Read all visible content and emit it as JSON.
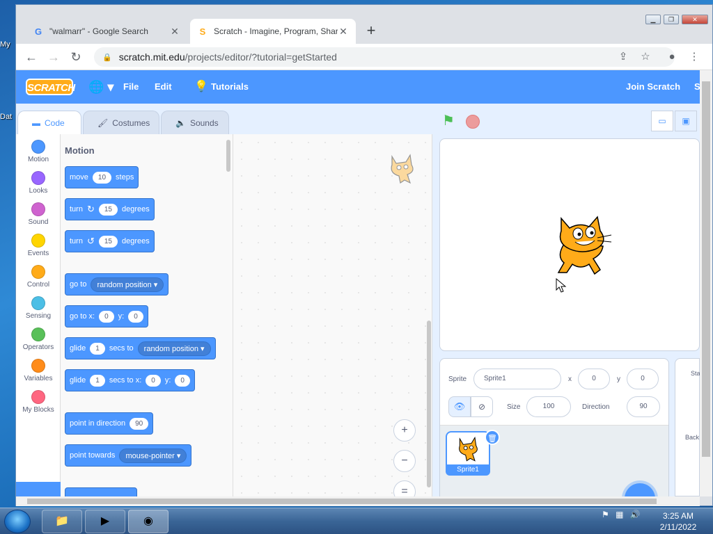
{
  "desktop": {
    "icons": [
      "My",
      "Dat"
    ]
  },
  "browser": {
    "tabs": [
      {
        "title": "\"walmarr\" - Google Search",
        "favicon": "G",
        "active": false
      },
      {
        "title": "Scratch - Imagine, Program, Shar",
        "favicon": "S",
        "active": true
      }
    ],
    "new_tab": "+",
    "url_domain": "scratch.mit.edu",
    "url_path": "/projects/editor/?tutorial=getStarted"
  },
  "scratch": {
    "logo": "SCRATCH",
    "menu": {
      "file": "File",
      "edit": "Edit",
      "tutorials": "Tutorials",
      "join": "Join Scratch",
      "signin": "S"
    },
    "tabs": {
      "code": "Code",
      "costumes": "Costumes",
      "sounds": "Sounds"
    },
    "categories": [
      {
        "label": "Motion",
        "color": "#4c97ff"
      },
      {
        "label": "Looks",
        "color": "#9966ff"
      },
      {
        "label": "Sound",
        "color": "#cf63cf"
      },
      {
        "label": "Events",
        "color": "#ffd500"
      },
      {
        "label": "Control",
        "color": "#ffab19"
      },
      {
        "label": "Sensing",
        "color": "#4cbfe6"
      },
      {
        "label": "Operators",
        "color": "#59c059"
      },
      {
        "label": "Variables",
        "color": "#ff8c1a"
      },
      {
        "label": "My Blocks",
        "color": "#ff6680"
      }
    ],
    "palette": {
      "heading": "Motion",
      "move": {
        "a": "move",
        "v": "10",
        "b": "steps"
      },
      "turn_right": {
        "a": "turn",
        "v": "15",
        "b": "degrees"
      },
      "turn_left": {
        "a": "turn",
        "v": "15",
        "b": "degrees"
      },
      "goto": {
        "a": "go to",
        "d": "random position"
      },
      "goto_xy": {
        "a": "go to x:",
        "x": "0",
        "b": "y:",
        "y": "0"
      },
      "glide_to": {
        "a": "glide",
        "v": "1",
        "b": "secs to",
        "d": "random position"
      },
      "glide_xy": {
        "a": "glide",
        "v": "1",
        "b": "secs to x:",
        "x": "0",
        "c": "y:",
        "y": "0"
      },
      "point_dir": {
        "a": "point in direction",
        "v": "90"
      },
      "point_towards": {
        "a": "point towards",
        "d": "mouse-pointer"
      }
    },
    "zoom": {
      "in": "+",
      "out": "−",
      "reset": "="
    },
    "sprite": {
      "label": "Sprite",
      "name": "Sprite1",
      "x_label": "x",
      "x": "0",
      "y_label": "y",
      "y": "0",
      "size_label": "Size",
      "size": "100",
      "direction_label": "Direction",
      "direction": "90"
    },
    "sprite_list": [
      {
        "name": "Sprite1"
      }
    ],
    "stage_pane": {
      "label": "Sta",
      "backdrops": "Back"
    }
  },
  "taskbar": {
    "time": "3:25 AM",
    "date": "2/11/2022"
  }
}
